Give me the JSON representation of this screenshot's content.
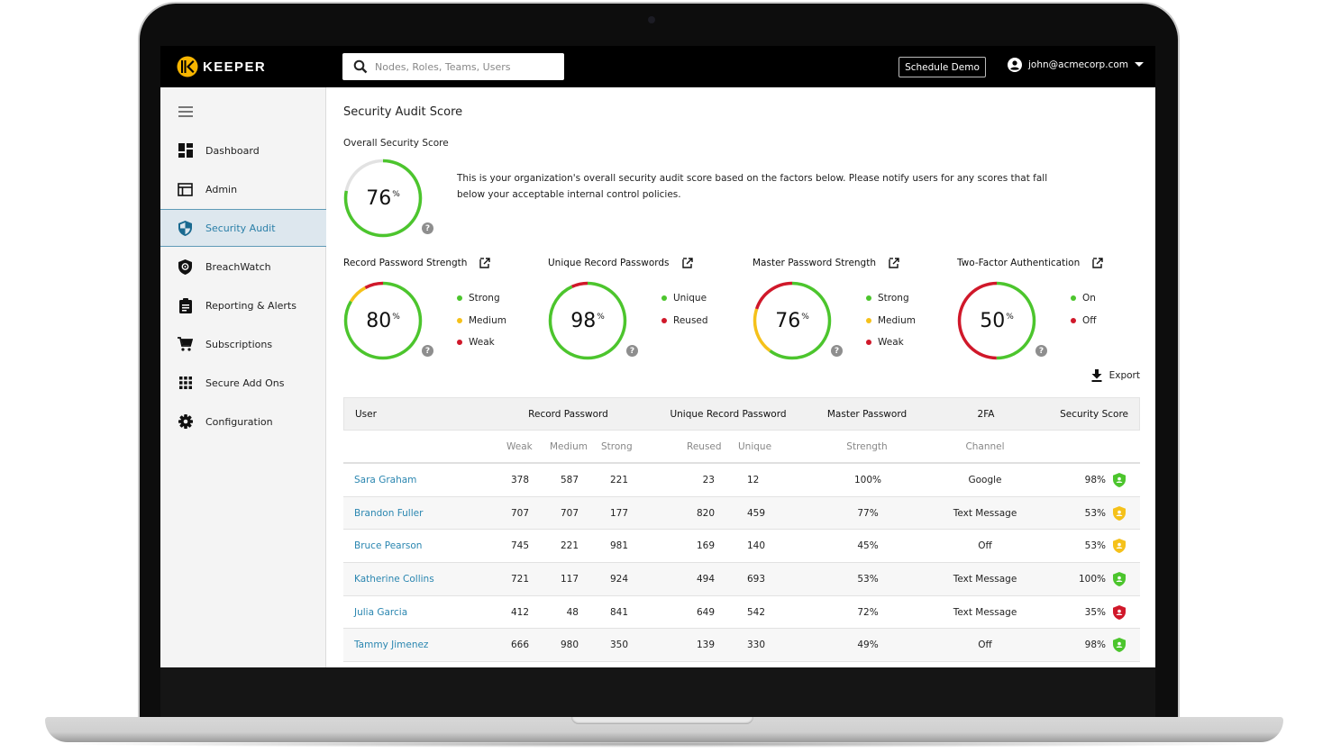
{
  "app": {
    "brand": "KEEPER",
    "search_placeholder": "Nodes, Roles, Teams, Users",
    "schedule_demo": "Schedule Demo",
    "user_email": "john@acmecorp.com"
  },
  "sidebar": {
    "items": [
      {
        "label": "Dashboard",
        "icon": "dashboard-icon"
      },
      {
        "label": "Admin",
        "icon": "admin-icon"
      },
      {
        "label": "Security Audit",
        "icon": "shield-icon",
        "active": true
      },
      {
        "label": "BreachWatch",
        "icon": "breachwatch-icon"
      },
      {
        "label": "Reporting & Alerts",
        "icon": "clipboard-icon"
      },
      {
        "label": "Subscriptions",
        "icon": "cart-icon"
      },
      {
        "label": "Secure Add Ons",
        "icon": "grid-icon"
      },
      {
        "label": "Configuration",
        "icon": "gear-icon"
      }
    ]
  },
  "main": {
    "title": "Security Audit Score",
    "overall": {
      "label": "Overall Security Score",
      "value": "76",
      "percent": 76,
      "description": "This is your organization's overall security audit score based on the factors below. Please notify users for any scores that fall below your acceptable internal control policies."
    },
    "cards": [
      {
        "title": "Record Password Strength",
        "value": "80",
        "segments": [
          {
            "color": "#4cc52d",
            "fraction": 0.835
          },
          {
            "color": "#f5c11a",
            "fraction": 0.085
          },
          {
            "color": "#d0182a",
            "fraction": 0.08
          }
        ],
        "legend": [
          {
            "label": "Strong",
            "color": "#4cc52d"
          },
          {
            "label": "Medium",
            "color": "#f5c11a"
          },
          {
            "label": "Weak",
            "color": "#d0182a"
          }
        ]
      },
      {
        "title": "Unique Record Passwords",
        "value": "98",
        "segments": [
          {
            "color": "#4cc52d",
            "fraction": 0.93
          },
          {
            "color": "#d0182a",
            "fraction": 0.07
          }
        ],
        "legend": [
          {
            "label": "Unique",
            "color": "#4cc52d"
          },
          {
            "label": "Reused",
            "color": "#d0182a"
          }
        ]
      },
      {
        "title": "Master Password Strength",
        "value": "76",
        "segments": [
          {
            "color": "#4cc52d",
            "fraction": 0.6
          },
          {
            "color": "#f5c11a",
            "fraction": 0.2
          },
          {
            "color": "#d0182a",
            "fraction": 0.2
          }
        ],
        "legend": [
          {
            "label": "Strong",
            "color": "#4cc52d"
          },
          {
            "label": "Medium",
            "color": "#f5c11a"
          },
          {
            "label": "Weak",
            "color": "#d0182a"
          }
        ]
      },
      {
        "title": "Two-Factor Authentication",
        "value": "50",
        "segments": [
          {
            "color": "#4cc52d",
            "fraction": 0.5
          },
          {
            "color": "#d0182a",
            "fraction": 0.5
          }
        ],
        "legend": [
          {
            "label": "On",
            "color": "#4cc52d"
          },
          {
            "label": "Off",
            "color": "#d0182a"
          }
        ]
      }
    ],
    "export_label": "Export",
    "table": {
      "headers": [
        "User",
        "Record Password",
        "Unique Record Password",
        "Master Password",
        "2FA",
        "Security Score"
      ],
      "subheaders": {
        "weak": "Weak",
        "medium": "Medium",
        "strong": "Strong",
        "reused": "Reused",
        "unique": "Unique",
        "strength": "Strength",
        "channel": "Channel"
      },
      "rows": [
        {
          "user": "Sara Graham",
          "weak": "378",
          "medium": "587",
          "strong": "221",
          "reused": "23",
          "unique": "12",
          "master": "100%",
          "channel": "Google",
          "score": "98%",
          "status": "#4cc52d"
        },
        {
          "user": "Brandon Fuller",
          "weak": "707",
          "medium": "707",
          "strong": "177",
          "reused": "820",
          "unique": "459",
          "master": "77%",
          "channel": "Text Message",
          "score": "53%",
          "status": "#f5c11a"
        },
        {
          "user": "Bruce Pearson",
          "weak": "745",
          "medium": "221",
          "strong": "981",
          "reused": "169",
          "unique": "140",
          "master": "45%",
          "channel": "Off",
          "score": "53%",
          "status": "#f5c11a"
        },
        {
          "user": "Katherine Collins",
          "weak": "721",
          "medium": "117",
          "strong": "924",
          "reused": "494",
          "unique": "693",
          "master": "53%",
          "channel": "Text Message",
          "score": "100%",
          "status": "#4cc52d"
        },
        {
          "user": "Julia Garcia",
          "weak": "412",
          "medium": "48",
          "strong": "841",
          "reused": "649",
          "unique": "542",
          "master": "72%",
          "channel": "Text Message",
          "score": "35%",
          "status": "#d0182a"
        },
        {
          "user": "Tammy Jimenez",
          "weak": "666",
          "medium": "980",
          "strong": "350",
          "reused": "139",
          "unique": "330",
          "master": "49%",
          "channel": "Off",
          "score": "98%",
          "status": "#4cc52d"
        }
      ]
    }
  },
  "colors": {
    "green": "#4cc52d",
    "yellow": "#f5c11a",
    "red": "#d0182a",
    "track": "#e2e2e2",
    "link": "#2a86b0",
    "brand_yellow": "#f7b500"
  }
}
